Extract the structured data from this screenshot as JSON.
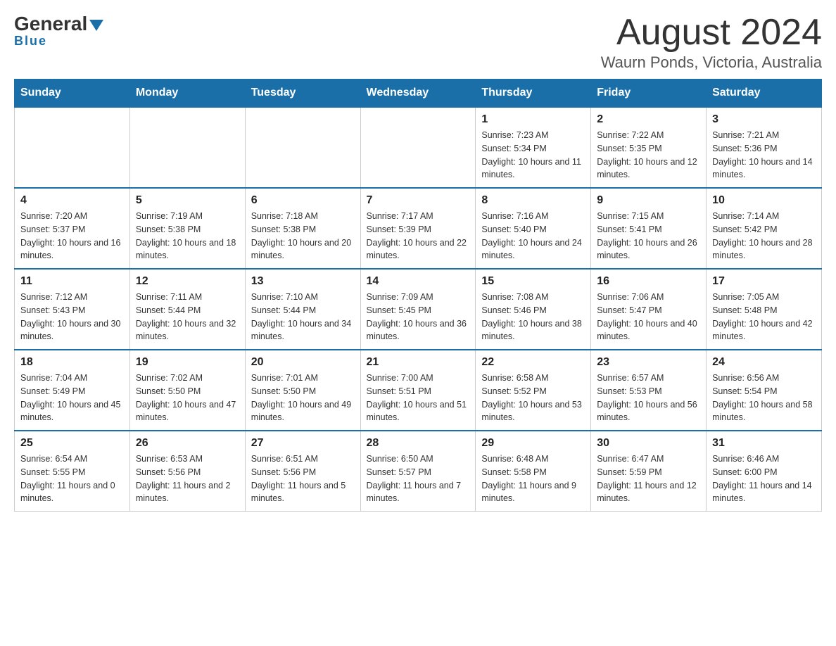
{
  "header": {
    "logo_general": "General",
    "logo_blue": "Blue",
    "main_title": "August 2024",
    "subtitle": "Waurn Ponds, Victoria, Australia"
  },
  "days_of_week": [
    "Sunday",
    "Monday",
    "Tuesday",
    "Wednesday",
    "Thursday",
    "Friday",
    "Saturday"
  ],
  "weeks": [
    [
      {
        "day": "",
        "info": ""
      },
      {
        "day": "",
        "info": ""
      },
      {
        "day": "",
        "info": ""
      },
      {
        "day": "",
        "info": ""
      },
      {
        "day": "1",
        "info": "Sunrise: 7:23 AM\nSunset: 5:34 PM\nDaylight: 10 hours and 11 minutes."
      },
      {
        "day": "2",
        "info": "Sunrise: 7:22 AM\nSunset: 5:35 PM\nDaylight: 10 hours and 12 minutes."
      },
      {
        "day": "3",
        "info": "Sunrise: 7:21 AM\nSunset: 5:36 PM\nDaylight: 10 hours and 14 minutes."
      }
    ],
    [
      {
        "day": "4",
        "info": "Sunrise: 7:20 AM\nSunset: 5:37 PM\nDaylight: 10 hours and 16 minutes."
      },
      {
        "day": "5",
        "info": "Sunrise: 7:19 AM\nSunset: 5:38 PM\nDaylight: 10 hours and 18 minutes."
      },
      {
        "day": "6",
        "info": "Sunrise: 7:18 AM\nSunset: 5:38 PM\nDaylight: 10 hours and 20 minutes."
      },
      {
        "day": "7",
        "info": "Sunrise: 7:17 AM\nSunset: 5:39 PM\nDaylight: 10 hours and 22 minutes."
      },
      {
        "day": "8",
        "info": "Sunrise: 7:16 AM\nSunset: 5:40 PM\nDaylight: 10 hours and 24 minutes."
      },
      {
        "day": "9",
        "info": "Sunrise: 7:15 AM\nSunset: 5:41 PM\nDaylight: 10 hours and 26 minutes."
      },
      {
        "day": "10",
        "info": "Sunrise: 7:14 AM\nSunset: 5:42 PM\nDaylight: 10 hours and 28 minutes."
      }
    ],
    [
      {
        "day": "11",
        "info": "Sunrise: 7:12 AM\nSunset: 5:43 PM\nDaylight: 10 hours and 30 minutes."
      },
      {
        "day": "12",
        "info": "Sunrise: 7:11 AM\nSunset: 5:44 PM\nDaylight: 10 hours and 32 minutes."
      },
      {
        "day": "13",
        "info": "Sunrise: 7:10 AM\nSunset: 5:44 PM\nDaylight: 10 hours and 34 minutes."
      },
      {
        "day": "14",
        "info": "Sunrise: 7:09 AM\nSunset: 5:45 PM\nDaylight: 10 hours and 36 minutes."
      },
      {
        "day": "15",
        "info": "Sunrise: 7:08 AM\nSunset: 5:46 PM\nDaylight: 10 hours and 38 minutes."
      },
      {
        "day": "16",
        "info": "Sunrise: 7:06 AM\nSunset: 5:47 PM\nDaylight: 10 hours and 40 minutes."
      },
      {
        "day": "17",
        "info": "Sunrise: 7:05 AM\nSunset: 5:48 PM\nDaylight: 10 hours and 42 minutes."
      }
    ],
    [
      {
        "day": "18",
        "info": "Sunrise: 7:04 AM\nSunset: 5:49 PM\nDaylight: 10 hours and 45 minutes."
      },
      {
        "day": "19",
        "info": "Sunrise: 7:02 AM\nSunset: 5:50 PM\nDaylight: 10 hours and 47 minutes."
      },
      {
        "day": "20",
        "info": "Sunrise: 7:01 AM\nSunset: 5:50 PM\nDaylight: 10 hours and 49 minutes."
      },
      {
        "day": "21",
        "info": "Sunrise: 7:00 AM\nSunset: 5:51 PM\nDaylight: 10 hours and 51 minutes."
      },
      {
        "day": "22",
        "info": "Sunrise: 6:58 AM\nSunset: 5:52 PM\nDaylight: 10 hours and 53 minutes."
      },
      {
        "day": "23",
        "info": "Sunrise: 6:57 AM\nSunset: 5:53 PM\nDaylight: 10 hours and 56 minutes."
      },
      {
        "day": "24",
        "info": "Sunrise: 6:56 AM\nSunset: 5:54 PM\nDaylight: 10 hours and 58 minutes."
      }
    ],
    [
      {
        "day": "25",
        "info": "Sunrise: 6:54 AM\nSunset: 5:55 PM\nDaylight: 11 hours and 0 minutes."
      },
      {
        "day": "26",
        "info": "Sunrise: 6:53 AM\nSunset: 5:56 PM\nDaylight: 11 hours and 2 minutes."
      },
      {
        "day": "27",
        "info": "Sunrise: 6:51 AM\nSunset: 5:56 PM\nDaylight: 11 hours and 5 minutes."
      },
      {
        "day": "28",
        "info": "Sunrise: 6:50 AM\nSunset: 5:57 PM\nDaylight: 11 hours and 7 minutes."
      },
      {
        "day": "29",
        "info": "Sunrise: 6:48 AM\nSunset: 5:58 PM\nDaylight: 11 hours and 9 minutes."
      },
      {
        "day": "30",
        "info": "Sunrise: 6:47 AM\nSunset: 5:59 PM\nDaylight: 11 hours and 12 minutes."
      },
      {
        "day": "31",
        "info": "Sunrise: 6:46 AM\nSunset: 6:00 PM\nDaylight: 11 hours and 14 minutes."
      }
    ]
  ]
}
